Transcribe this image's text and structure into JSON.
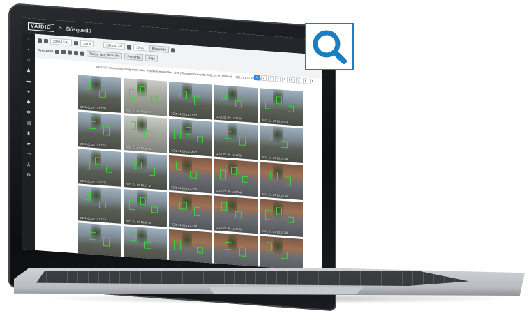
{
  "app": {
    "logo": "VAIDIO",
    "breadcrumb_separator": ">",
    "page_title": "Búsqueda"
  },
  "toolbar": {
    "row1": {
      "start_date": "2020-12-31",
      "start_time": "10:00",
      "end_date": "2021-01-31",
      "end_time": "22:00",
      "search_button": "Búsqueda"
    },
    "row2": {
      "label": "Avanzada",
      "filter_object": "Todos_tipo_vehículos",
      "filter_color": "Personas",
      "filter_more": "Rojo"
    }
  },
  "results": {
    "summary": "Total: 153 results en 0.3 segundos Alias: Registros evaluados: 1135 | Tiempo de consulta 2021-01-20 10:00:00 ~ 2021-01-31 10:00:00",
    "pages": [
      "1",
      "2",
      "3",
      "4",
      "5",
      "6",
      "7",
      "8",
      "9"
    ],
    "active_page": "1",
    "thumbnails": [
      {
        "time": "2021-01-29 10:02:34",
        "scene": "street"
      },
      {
        "time": "2021-01-28 10:22:21",
        "scene": "park"
      },
      {
        "time": "2021-01-28 10:41:12",
        "scene": "street"
      },
      {
        "time": "2021-01-29 10:35:07",
        "scene": "street"
      },
      {
        "time": "2021-01-29 10:49:53",
        "scene": "street"
      },
      {
        "time": "2021-01-28 10:52:14",
        "scene": "street"
      },
      {
        "time": "2021-01-29 10:19:22",
        "scene": "park"
      },
      {
        "time": "2021-01-29 10:34:47",
        "scene": "street"
      },
      {
        "time": "2021-01-29 10:10:33",
        "scene": "street"
      },
      {
        "time": "2021-01-29 10:54:04",
        "scene": "street"
      },
      {
        "time": "2021-01-29 10:45:21",
        "scene": "street"
      },
      {
        "time": "2021-01-29 10:17:04",
        "scene": "street"
      },
      {
        "time": "2021-01-29 10:33:15",
        "scene": "road"
      },
      {
        "time": "2021-01-29 10:26:45",
        "scene": "road"
      },
      {
        "time": "2021-01-29 10:19:59",
        "scene": "road"
      },
      {
        "time": "2021-01-29 10:51:16",
        "scene": "street"
      },
      {
        "time": "2021-01-29 10:36:48",
        "scene": "street"
      },
      {
        "time": "2021-01-29 10:43:08",
        "scene": "road"
      },
      {
        "time": "2021-01-29 10:45:51",
        "scene": "road"
      },
      {
        "time": "2021-01-29 10:52:38",
        "scene": "road"
      },
      {
        "time": "2021-01-29 10:44:22",
        "scene": "street"
      },
      {
        "time": "2021-01-29 10:48:35",
        "scene": "street"
      },
      {
        "time": "2021-01-29 10:41:52",
        "scene": "road"
      },
      {
        "time": "2021-01-29 10:17:18",
        "scene": "road"
      },
      {
        "time": "2021-01-29 10:20:03",
        "scene": "road"
      }
    ]
  },
  "colors": {
    "accent": "#2d8cdf",
    "detection_box": "#3cd23c",
    "badge_border": "#1a7ec2"
  },
  "icons": {
    "badge": "search-magnifier-icon"
  }
}
